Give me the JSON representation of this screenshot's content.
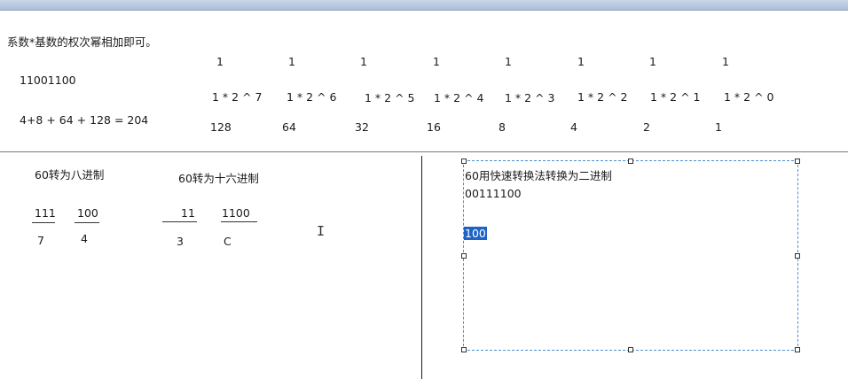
{
  "top": {
    "desc": "系数*基数的权次幂相加即可。",
    "binary": "11001100",
    "sum": "4+8 + 64 + 128 = 204",
    "coefficients": [
      "1",
      "1",
      "1",
      "1",
      "1",
      "1",
      "1",
      "1"
    ],
    "powers": [
      "1 * 2 ^ 7",
      "1 * 2 ^ 6",
      "1 * 2 ^ 5",
      "1 * 2 ^ 4",
      "1 * 2 ^ 3",
      "1 * 2 ^ 2",
      "1 * 2 ^ 1",
      "1 * 2 ^ 0"
    ],
    "weights": [
      "128",
      "64",
      "32",
      "16",
      "8",
      "4",
      "2",
      "1"
    ]
  },
  "octal": {
    "title": "60转为八进制",
    "groups": [
      "111",
      "100"
    ],
    "digits": [
      "7",
      "4"
    ]
  },
  "hex": {
    "title": "60转为十六进制",
    "groups": [
      "11",
      "1100"
    ],
    "digits": [
      "3",
      "C"
    ]
  },
  "textbox": {
    "title": "60用快速转换法转换为二进制",
    "value": "00111100",
    "selected": "100"
  },
  "colors": {
    "selection": "#1f63c7",
    "box_border": "#4a8fd4"
  },
  "icons": {
    "cursor": "text-cursor-icon"
  }
}
